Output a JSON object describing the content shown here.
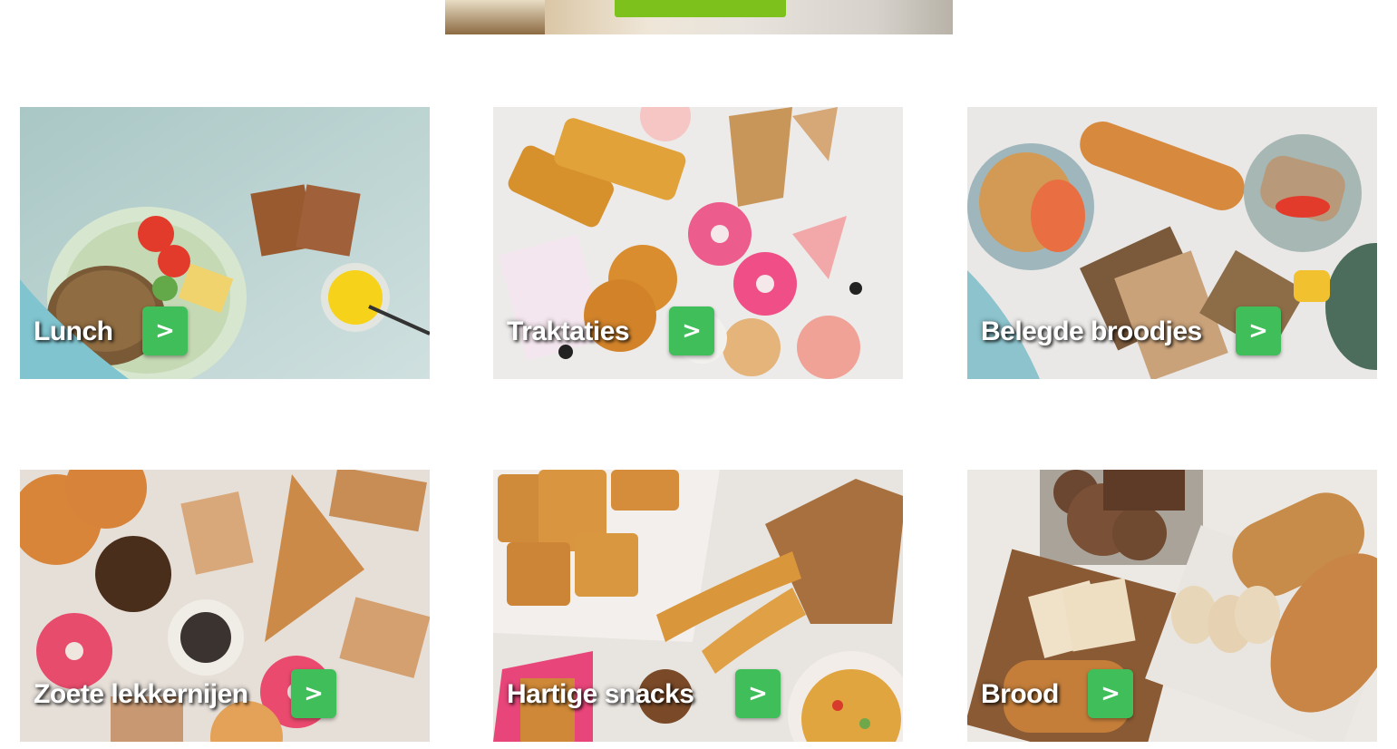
{
  "categories": [
    {
      "label": "Lunch",
      "arrow": ">"
    },
    {
      "label": "Traktaties",
      "arrow": ">"
    },
    {
      "label": "Belegde broodjes",
      "arrow": ">"
    },
    {
      "label": "Zoete lekkernijen",
      "arrow": ">"
    },
    {
      "label": "Hartige snacks",
      "arrow": ">"
    },
    {
      "label": "Brood",
      "arrow": ">"
    }
  ],
  "colors": {
    "arrow_button": "#3fbe5a",
    "banner_button": "#7cc11c",
    "label_text": "#ffffff"
  }
}
